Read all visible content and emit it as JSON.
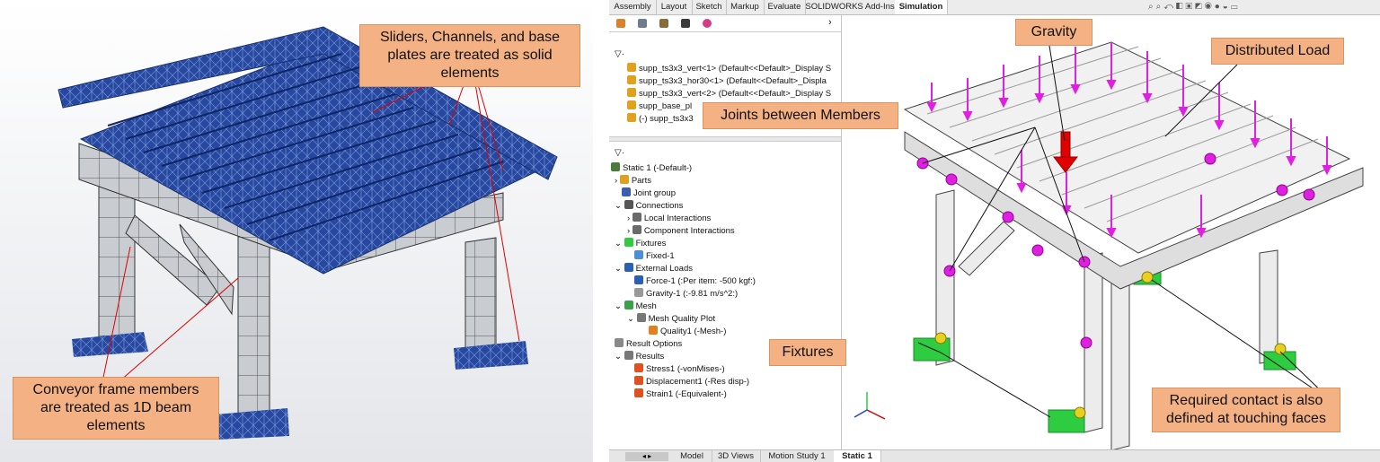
{
  "left_panel": {
    "callouts": {
      "solid": "Sliders, Channels, and base plates are treated as solid elements",
      "beam": "Conveyor frame members are treated as 1D beam elements"
    }
  },
  "right_panel": {
    "command_tabs": [
      "Assembly",
      "Layout",
      "Sketch",
      "Markup",
      "Evaluate",
      "SOLIDWORKS Add-Ins",
      "Simulation"
    ],
    "active_tab": "Simulation",
    "top_tree": [
      "supp_ts3x3_vert<1> (Default<<Default>_Display S",
      "supp_ts3x3_hor30<1> (Default<<Default>_Displa",
      "supp_ts3x3_vert<2> (Default<<Default>_Display S",
      "supp_base_pl",
      "(-) supp_ts3x3"
    ],
    "sim_tree": {
      "study": "Static 1 (-Default-)",
      "parts": "Parts",
      "joint_group": "Joint group",
      "connections": "Connections",
      "local_interactions": "Local Interactions",
      "component_interactions": "Component Interactions",
      "fixtures": "Fixtures",
      "fixed1": "Fixed-1",
      "external_loads": "External Loads",
      "force1": "Force-1 (:Per item: -500 kgf:)",
      "gravity1": "Gravity-1 (:-9.81 m/s^2:)",
      "mesh": "Mesh",
      "mesh_quality_plot": "Mesh Quality Plot",
      "quality1": "Quality1 (-Mesh-)",
      "result_options": "Result Options",
      "results": "Results",
      "stress1": "Stress1 (-vonMises-)",
      "displacement1": "Displacement1 (-Res disp-)",
      "strain1": "Strain1 (-Equivalent-)"
    },
    "callouts": {
      "gravity": "Gravity",
      "distributed_load": "Distributed Load",
      "joints": "Joints between Members",
      "fixtures": "Fixtures",
      "contact": "Required contact is also defined at touching faces"
    },
    "bottom_tabs": [
      "Model",
      "3D Views",
      "Motion Study 1",
      "Static 1"
    ],
    "active_bottom_tab": "Static 1",
    "colors": {
      "load_arrow": "#e020e0",
      "gravity_arrow": "#e00000",
      "fixture": "#2ecc40",
      "callout_bg": "#f4b183",
      "mesh_blue": "#1f3f9a"
    }
  }
}
